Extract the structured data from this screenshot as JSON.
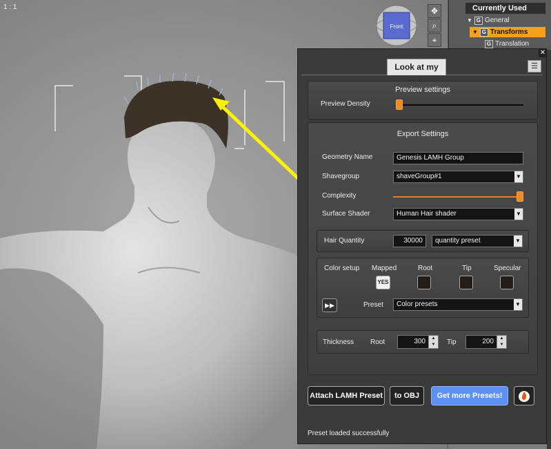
{
  "viewport": {
    "label": "1 : 1",
    "nav_cube_label": "Front"
  },
  "scene_tree": {
    "header": "Currently Used",
    "items": [
      {
        "icon": "G",
        "label": "General"
      },
      {
        "icon": "G",
        "label": "Transforms"
      },
      {
        "icon": "G",
        "label": "Translation"
      }
    ]
  },
  "panel": {
    "tab_title": "Look at my Hair",
    "close_label": "✕",
    "menu_label": "☰",
    "preview": {
      "title": "Preview settings",
      "density_label": "Preview Density",
      "density_value": 0.02
    },
    "export": {
      "title": "Export Settings",
      "geometry_name_label": "Geometry Name",
      "geometry_name_value": "Genesis LAMH Group",
      "shavegroup_label": "Shavegroup",
      "shavegroup_value": "shaveGroup#1",
      "complexity_label": "Complexity",
      "complexity_value": 0.99,
      "surface_shader_label": "Surface Shader",
      "surface_shader_value": "Human Hair shader"
    },
    "hair_quantity": {
      "label": "Hair Quantity",
      "value": "30000",
      "preset": "quantity preset"
    },
    "color_setup": {
      "label": "Color setup",
      "mapped_label": "Mapped",
      "mapped_value": "YES",
      "root_label": "Root",
      "tip_label": "Tip",
      "specular_label": "Specular",
      "preset_label": "Preset",
      "preset_value": "Color presets",
      "apply_label": "▶▶"
    },
    "thickness": {
      "label": "Thickness",
      "root_label": "Root",
      "root_value": "300",
      "tip_label": "Tip",
      "tip_value": "200"
    },
    "buttons": {
      "attach": "Attach LAMH Preset",
      "obj": "to OBJ",
      "more": "Get more Presets!"
    },
    "status": "Preset loaded successfully"
  },
  "colors": {
    "accent": "#f08a24",
    "primary_button": "#5d90f3",
    "swatch": "#241c16"
  }
}
